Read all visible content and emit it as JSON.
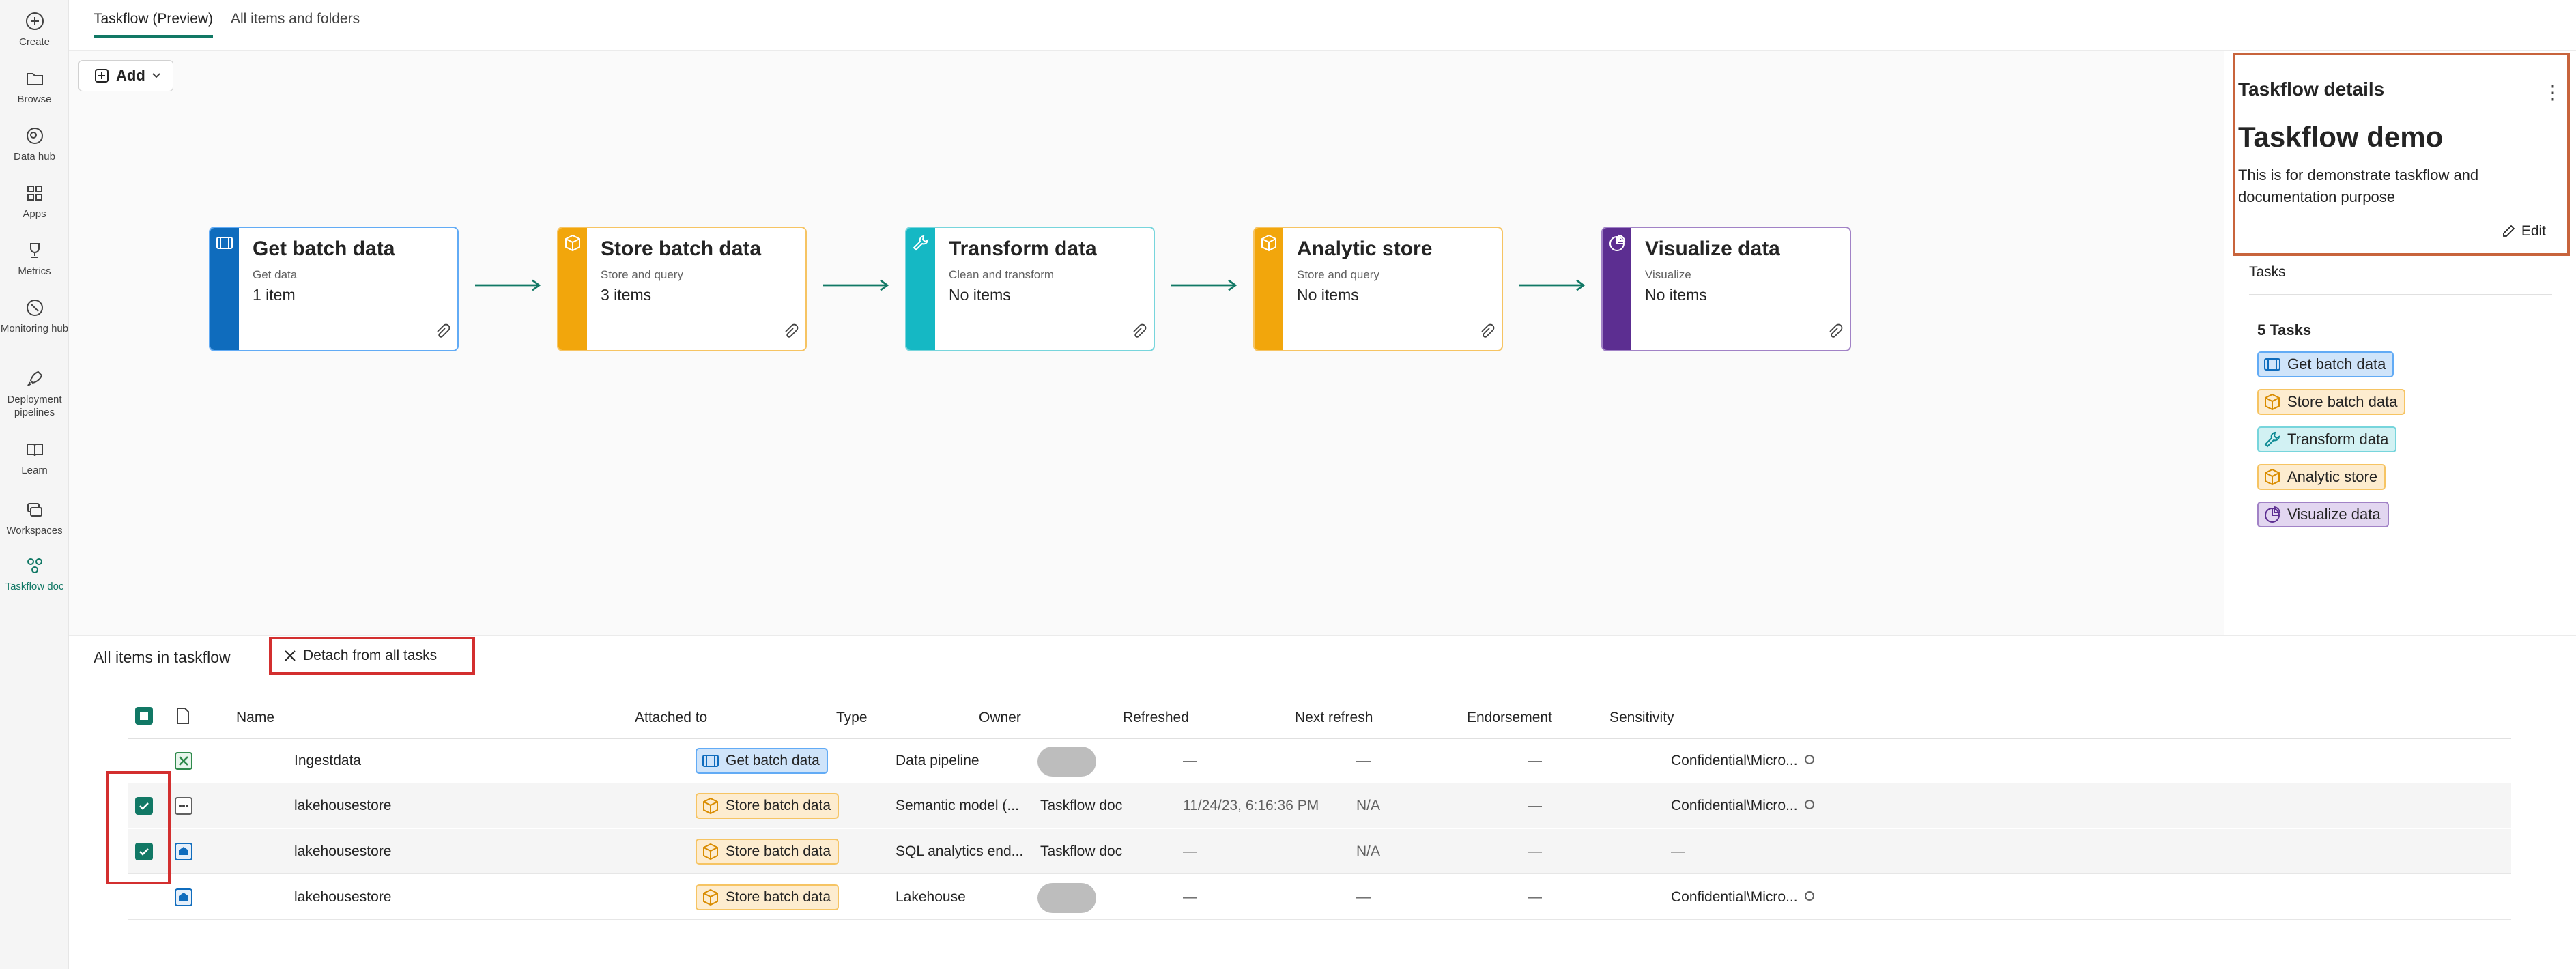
{
  "rail": [
    {
      "label": "Create",
      "icon": "plus-circle-icon"
    },
    {
      "label": "Browse",
      "icon": "folder-icon"
    },
    {
      "label": "Data hub",
      "icon": "data-hub-icon"
    },
    {
      "label": "Apps",
      "icon": "apps-icon"
    },
    {
      "label": "Metrics",
      "icon": "trophy-icon"
    },
    {
      "label": "Monitoring hub",
      "icon": "monitor-icon"
    },
    {
      "label": "Deployment pipelines",
      "icon": "rocket-icon"
    },
    {
      "label": "Learn",
      "icon": "book-icon"
    },
    {
      "label": "Workspaces",
      "icon": "workspaces-icon"
    },
    {
      "label": "Taskflow doc",
      "icon": "taskflow-icon"
    }
  ],
  "tabs": [
    {
      "label": "Taskflow (Preview)",
      "active": true
    },
    {
      "label": "All items and folders",
      "active": false
    }
  ],
  "canvas": {
    "add_label": "Add",
    "cards": [
      {
        "title": "Get batch data",
        "subtitle": "Get data",
        "count": "1 item",
        "color": "#0f6cbd",
        "border": "#62abf5",
        "icon": "get-data-icon"
      },
      {
        "title": "Store batch data",
        "subtitle": "Store and query",
        "count": "3 items",
        "color": "#f2a60c",
        "border": "#f6c463",
        "icon": "cube-icon"
      },
      {
        "title": "Transform data",
        "subtitle": "Clean and transform",
        "count": "No items",
        "color": "#15b8c4",
        "border": "#77d5dc",
        "icon": "wrench-icon"
      },
      {
        "title": "Analytic store",
        "subtitle": "Store and query",
        "count": "No items",
        "color": "#f2a60c",
        "border": "#f6c463",
        "icon": "cube-icon"
      },
      {
        "title": "Visualize data",
        "subtitle": "Visualize",
        "count": "No items",
        "color": "#5c2e91",
        "border": "#a182c6",
        "icon": "chart-icon"
      }
    ]
  },
  "details": {
    "heading": "Taskflow details",
    "name": "Taskflow demo",
    "description": "This is for demonstrate taskflow and documentation purpose",
    "edit_label": "Edit",
    "tasks_label": "Tasks",
    "tasks_count": "5 Tasks",
    "tasks": [
      {
        "label": "Get batch data",
        "bg": "#cfe4fa",
        "border": "#62abf5",
        "icon": "get-data-icon",
        "ic": "#0f6cbd"
      },
      {
        "label": "Store batch data",
        "bg": "#fdeccf",
        "border": "#f6c463",
        "icon": "cube-icon",
        "ic": "#d98c00"
      },
      {
        "label": "Transform data",
        "bg": "#d2f1f3",
        "border": "#77d5dc",
        "icon": "wrench-icon",
        "ic": "#0e8a94"
      },
      {
        "label": "Analytic store",
        "bg": "#fdeccf",
        "border": "#f6c463",
        "icon": "cube-icon",
        "ic": "#d98c00"
      },
      {
        "label": "Visualize data",
        "bg": "#e2d6f0",
        "border": "#a182c6",
        "icon": "chart-icon",
        "ic": "#5c2e91"
      }
    ]
  },
  "items": {
    "title": "All items in taskflow",
    "detach_label": "Detach from all tasks",
    "columns": [
      "Name",
      "Attached to",
      "Type",
      "Owner",
      "Refreshed",
      "Next refresh",
      "Endorsement",
      "Sensitivity"
    ],
    "rows": [
      {
        "name": "Ingestdata",
        "attached": "Get batch data",
        "attached_kind": "get",
        "type": "Data pipeline",
        "owner": "",
        "refreshed": "—",
        "next": "—",
        "endorsement": "—",
        "sensitivity": "Confidential\\Micro...",
        "checked": false,
        "icon": "pipeline-icon"
      },
      {
        "name": "lakehousestore",
        "attached": "Store batch data",
        "attached_kind": "store",
        "type": "Semantic model (...",
        "owner": "Taskflow doc",
        "refreshed": "11/24/23, 6:16:36 PM",
        "next": "N/A",
        "endorsement": "—",
        "sensitivity": "Confidential\\Micro...",
        "checked": true,
        "icon": "semantic-model-icon"
      },
      {
        "name": "lakehousestore",
        "attached": "Store batch data",
        "attached_kind": "store",
        "type": "SQL analytics end...",
        "owner": "Taskflow doc",
        "refreshed": "—",
        "next": "N/A",
        "endorsement": "—",
        "sensitivity": "—",
        "checked": true,
        "icon": "sql-endpoint-icon"
      },
      {
        "name": "lakehousestore",
        "attached": "Store batch data",
        "attached_kind": "store",
        "type": "Lakehouse",
        "owner": "",
        "refreshed": "—",
        "next": "—",
        "endorsement": "—",
        "sensitivity": "Confidential\\Micro...",
        "checked": false,
        "icon": "lakehouse-icon"
      }
    ]
  }
}
